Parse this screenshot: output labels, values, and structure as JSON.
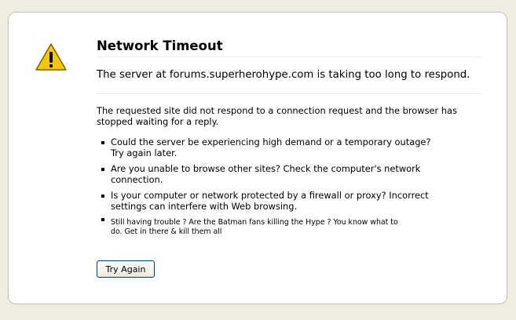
{
  "error": {
    "title": "Network Timeout",
    "short_desc": "The server at forums.superherohype.com is taking too long to respond.",
    "long_desc": "The requested site did not respond to a connection request and the browser has stopped waiting for a reply.",
    "bullets": [
      "Could the server be experiencing high demand or a temporary outage? Try again later.",
      "Are you unable to browse other sites? Check the computer's network connection.",
      "Is your computer or network protected by a firewall or proxy? Incorrect settings can interfere with Web browsing.",
      "Still having trouble ?  Are the Batman fans killing the Hype ?  You know what to do.  Get in there & kill them all"
    ],
    "try_again_label": "Try Again",
    "icon": "warning-icon"
  },
  "colors": {
    "background": "#efece2",
    "panel": "#ffffff",
    "panel_border": "#c5c0ad",
    "warning_yellow": "#f5c800"
  }
}
